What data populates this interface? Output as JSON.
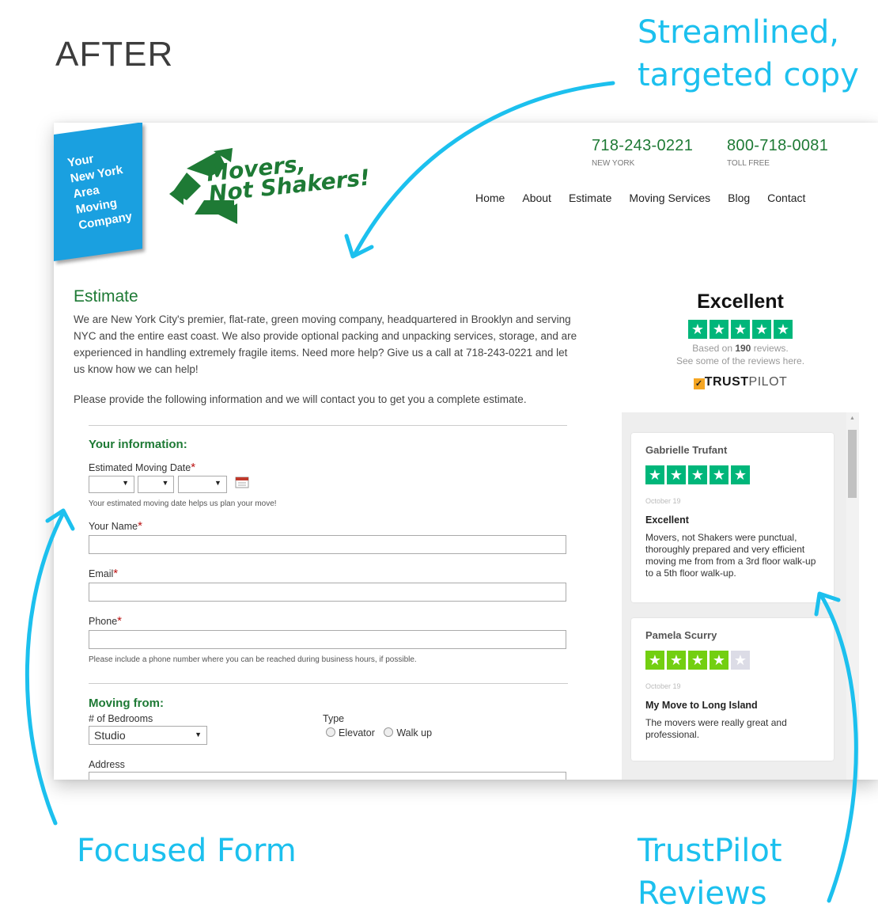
{
  "heading": "AFTER",
  "callouts": {
    "copy": [
      "Streamlined,",
      "targeted copy"
    ],
    "form": "Focused Form",
    "reviews": [
      "TrustPilot",
      "Reviews"
    ]
  },
  "header": {
    "badge_lines": [
      "Your",
      "New York",
      "Area",
      "Moving",
      "Company"
    ],
    "logo_lines": [
      "Movers,",
      "Not Shakers!"
    ],
    "phones": [
      {
        "number": "718-243-0221",
        "label": "NEW YORK"
      },
      {
        "number": "800-718-0081",
        "label": "TOLL FREE"
      }
    ],
    "nav": [
      "Home",
      "About",
      "Estimate",
      "Moving Services",
      "Blog",
      "Contact"
    ]
  },
  "main": {
    "title": "Estimate",
    "intro": "We are New York City's premier, flat-rate, green moving company, headquartered in Brooklyn and serving NYC and the entire east coast. We also provide optional packing and unpacking services, storage, and are experienced in handling extremely fragile items. Need more help? Give us a call at 718-243-0221 and let us know how we can help!",
    "intro2": "Please provide the following information and we will contact you to get you a complete estimate."
  },
  "form": {
    "your_info_title": "Your information:",
    "moving_date_label": "Estimated Moving Date",
    "moving_date_hint": "Your estimated moving date helps us plan your move!",
    "name_label": "Your Name",
    "email_label": "Email",
    "phone_label": "Phone",
    "phone_hint": "Please include a phone number where you can be reached during business hours, if possible.",
    "required_mark": "*",
    "moving_from_title": "Moving from:",
    "bedrooms_label": "# of Bedrooms",
    "bedrooms_value": "Studio",
    "type_label": "Type",
    "type_options": [
      "Elevator",
      "Walk up"
    ],
    "address_label": "Address"
  },
  "trustpilot": {
    "rating_word": "Excellent",
    "based_on_prefix": "Based on ",
    "review_count": "190",
    "based_on_suffix": " reviews.",
    "see_reviews": "See some of the reviews here.",
    "logo_trust": "TRUST",
    "logo_pilot": "PILOT",
    "brand_color": "#00b67a",
    "reviews": [
      {
        "name": "Gabrielle Trufant",
        "stars": 5,
        "date": "October 19",
        "title": "Excellent",
        "body": "Movers, not Shakers were punctual, thoroughly prepared and very efficient moving me from from a 3rd floor walk-up to a 5th floor walk-up."
      },
      {
        "name": "Pamela Scurry",
        "stars": 4,
        "date": "October 19",
        "title": "My Move to Long Island",
        "body": "The movers were really great and professional."
      }
    ]
  },
  "colors": {
    "callout": "#1cc0ee",
    "brand_green": "#1e7a35",
    "badge_blue": "#1aa0e0"
  }
}
